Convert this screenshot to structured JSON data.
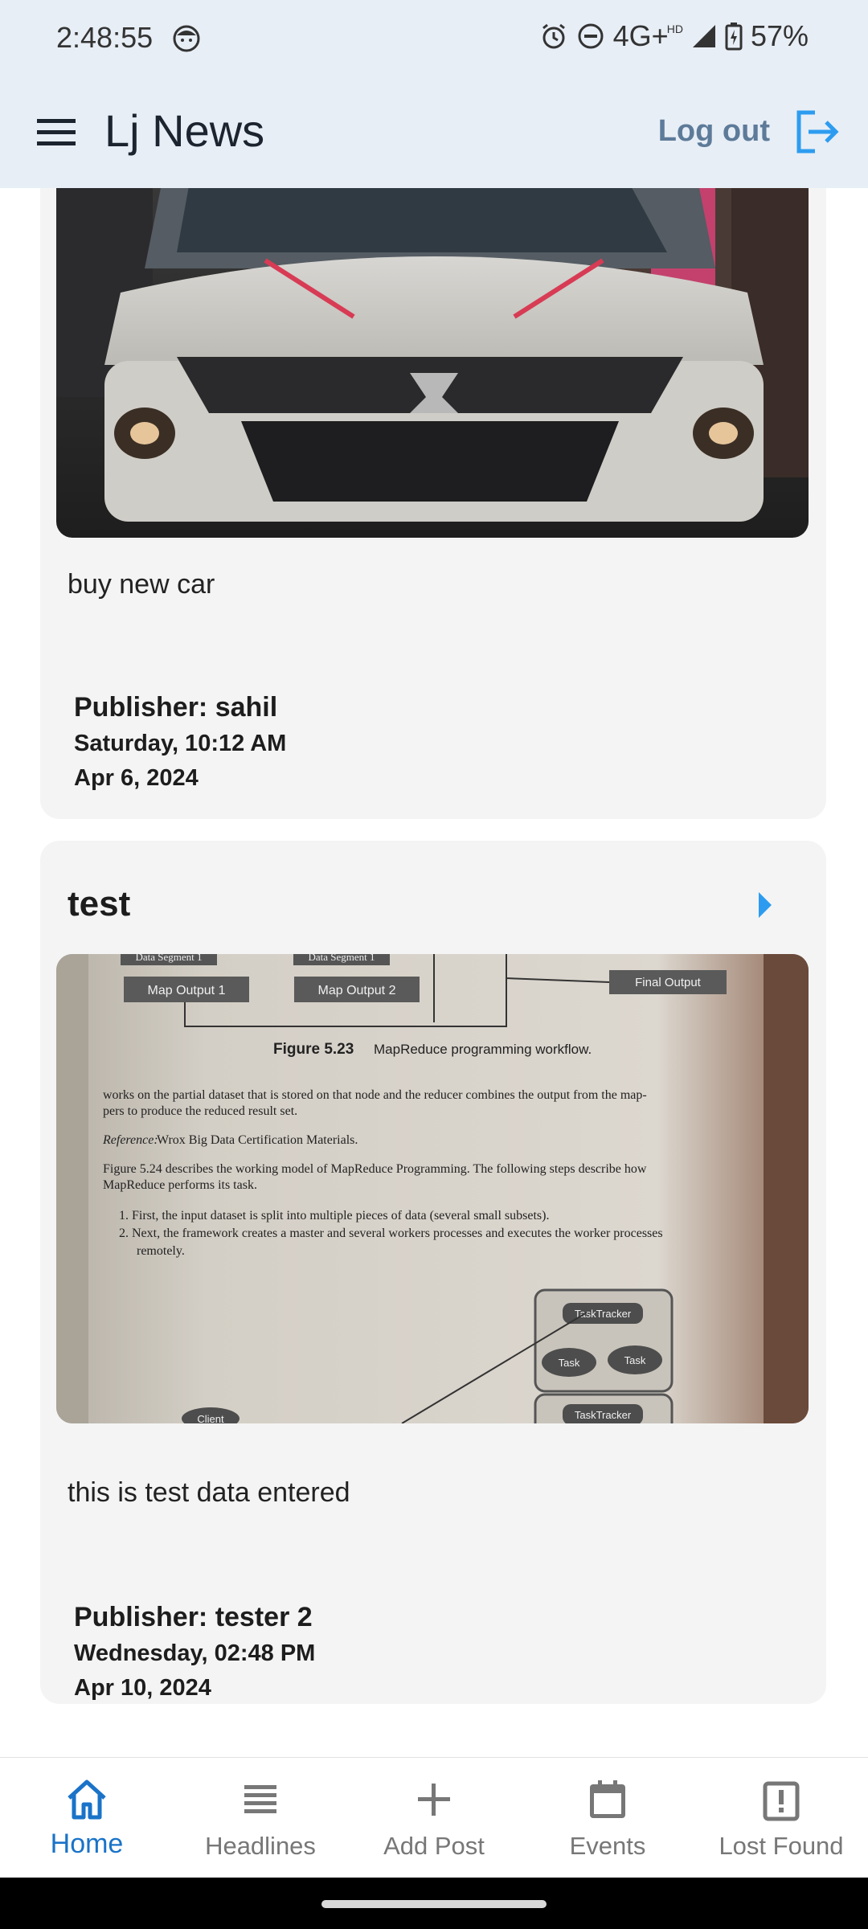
{
  "status_bar": {
    "time": "2:48:55",
    "network": "4G+",
    "hd": "HD",
    "battery": "57%"
  },
  "app_bar": {
    "title": "Lj News",
    "logout_label": "Log out"
  },
  "posts": [
    {
      "title": "",
      "image": "photo of white suzuki car",
      "description": "buy new car",
      "publisher": "Publisher: sahil",
      "day_time": "Saturday, 10:12 AM",
      "date": "Apr 6, 2024"
    },
    {
      "title": "test",
      "image": "photo of textbook page",
      "description": "this is test data entered",
      "publisher": "Publisher: tester 2",
      "day_time": "Wednesday, 02:48 PM",
      "date": "Apr 10, 2024",
      "page_text": {
        "box1": "Map Output 1",
        "box2": "Map Output 2",
        "box3": "Final Output",
        "box_top1": "Data Segment 1",
        "box_top2": "Data Segment 1",
        "figure_label": "Figure 5.23",
        "figure_caption": "MapReduce programming workflow.",
        "para1": "works on the partial dataset that is stored on that node and the reducer combines the output from the map-",
        "para1b": "pers to produce the reduced result set.",
        "reference_label": "Reference:",
        "reference_text": "Wrox Big Data Certification Materials.",
        "para2": "Figure 5.24 describes the working model of MapReduce Programming. The following steps describe how",
        "para2b": "MapReduce performs its task.",
        "step1": "1.  First, the input dataset is split into multiple pieces of data (several small subsets).",
        "step2": "2.  Next, the framework creates a master and several workers processes and executes the worker processes",
        "step2b": "remotely.",
        "tracker1": "TaskTracker",
        "task1": "Task",
        "task2": "Task",
        "tracker2": "TaskTracker",
        "client": "Client"
      }
    }
  ],
  "bottom_nav": [
    {
      "label": "Home",
      "icon": "home-icon",
      "active": true
    },
    {
      "label": "Headlines",
      "icon": "list-icon",
      "active": false
    },
    {
      "label": "Add Post",
      "icon": "plus-icon",
      "active": false
    },
    {
      "label": "Events",
      "icon": "calendar-icon",
      "active": false
    },
    {
      "label": "Lost Found",
      "icon": "report-icon",
      "active": false
    }
  ],
  "colors": {
    "app_bar_bg": "#e8eef6",
    "accent": "#1a73c8",
    "logout_icon": "#2d9cf0",
    "card_bg": "#f4f4f4"
  }
}
